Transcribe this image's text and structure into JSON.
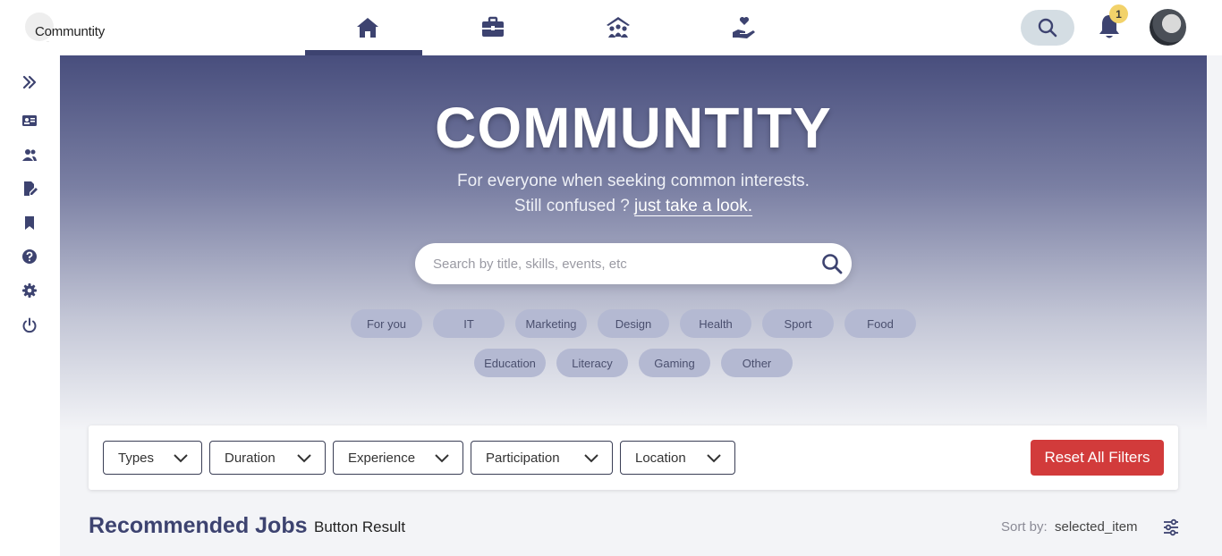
{
  "brand": {
    "name": "Communtity",
    "tagline": "..."
  },
  "nav": {
    "items": [
      {
        "icon": "home-icon",
        "active": true
      },
      {
        "icon": "briefcase-icon",
        "active": false
      },
      {
        "icon": "community-icon",
        "active": false
      },
      {
        "icon": "volunteer-hand-heart-icon",
        "active": false
      }
    ]
  },
  "header": {
    "notification_count": "1"
  },
  "sidebar": {
    "icons": [
      "expand-icon",
      "id-card-icon",
      "users-icon",
      "edit-document-icon",
      "bookmark-icon",
      "help-icon",
      "settings-icon",
      "power-icon"
    ]
  },
  "hero": {
    "title": "COMMUNTITY",
    "subtitle_line1": "For everyone when seeking common interests.",
    "subtitle_line2_prefix": "Still confused ? ",
    "subtitle_link": "just take a look.",
    "search_placeholder": "Search by title, skills, events, etc"
  },
  "chips": {
    "row1": [
      "For you",
      "IT",
      "Marketing",
      "Design",
      "Health",
      "Sport",
      "Food"
    ],
    "row2": [
      "Education",
      "Literacy",
      "Gaming",
      "Other"
    ]
  },
  "filters": {
    "types": "Types",
    "duration": "Duration",
    "experience": "Experience",
    "participation": "Participation",
    "location": "Location",
    "reset": "Reset All Filters"
  },
  "results": {
    "title": "Recommended Jobs",
    "subtitle": "Button Result",
    "sort_label": "Sort by:",
    "sort_value": "selected_item"
  },
  "colors": {
    "primary": "#3d4370",
    "danger": "#d23b3b",
    "chip_bg": "#b4b9d2",
    "badge": "#f2d26a"
  }
}
